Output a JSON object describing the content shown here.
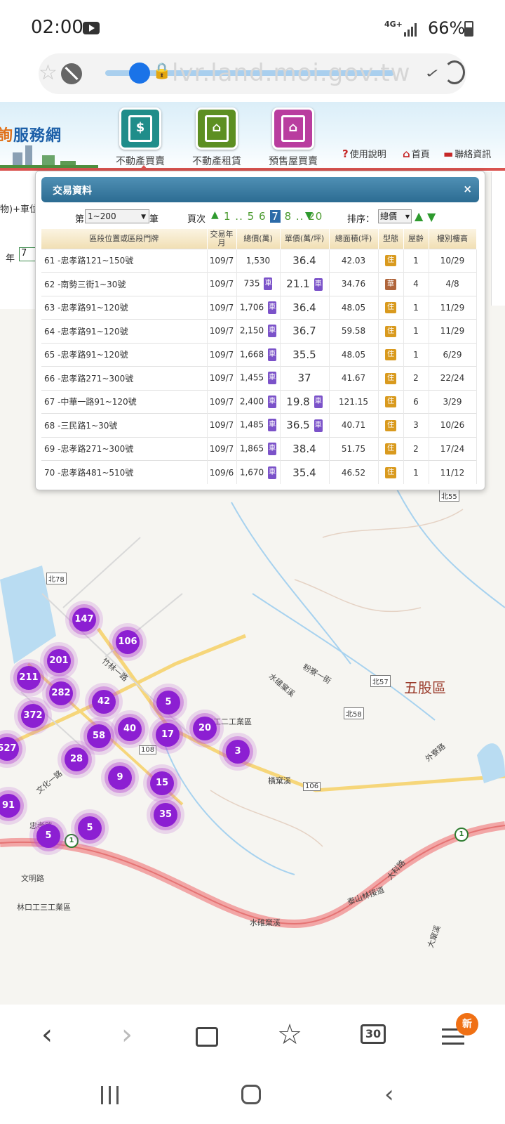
{
  "status_bar": {
    "time": "02:00",
    "network": "4G+",
    "battery_pct": "66%",
    "icons": [
      "youtube-icon",
      "signal-icon",
      "battery-icon"
    ]
  },
  "browser": {
    "url": "lvr.land.moi.gov.tw",
    "load_progress": 0.12,
    "tabs_count": "30",
    "menu_badge": "新",
    "icons": [
      "back-icon",
      "forward-icon",
      "home-icon",
      "bookmarks-icon",
      "tabs-icon",
      "menu-icon"
    ]
  },
  "site": {
    "logo_text_orange": "詢",
    "logo_text_blue": "服務網",
    "nav": [
      {
        "label": "不動產買賣",
        "icon_char": "$",
        "color": "#1f8d8a"
      },
      {
        "label": "不動產租賃",
        "icon_char": "⌂",
        "color": "#5d8f22"
      },
      {
        "label": "預售屋買賣",
        "icon_char": "⌂",
        "color": "#b93d9f"
      }
    ],
    "links": {
      "help": "使用說明",
      "home": "首頁",
      "contact": "聯絡資訊"
    }
  },
  "side_filter": {
    "label": "物)+車位",
    "year_label": "年",
    "year_value": "7"
  },
  "panel": {
    "title": "交易資料",
    "close": "×",
    "range_prefix": "第",
    "range_value": "1~200",
    "range_suffix": "筆",
    "pages_label": "頁次",
    "pages_before": "1 ..",
    "pages_mid_before": "5 6",
    "current_page": "7",
    "pages_after": "8 ..",
    "pages_last": "20",
    "sort_label": "排序：",
    "sort_value": "總價",
    "columns": [
      "區段位置或區段門牌",
      "交易年月",
      "總價(萬)",
      "單價(萬/坪)",
      "總面積(坪)",
      "型態",
      "屋齡",
      "樓別樓高"
    ],
    "rows": [
      {
        "addr": "61 -忠孝路121~150號",
        "date": "109/7",
        "total": "1,530",
        "total_car": false,
        "unit": "36.4",
        "unit_car": false,
        "area": "42.03",
        "type": "住",
        "age": "1",
        "floor": "10/29"
      },
      {
        "addr": "62 -南勢三街1~30號",
        "date": "109/7",
        "total": "735",
        "total_car": true,
        "unit": "21.1",
        "unit_car": true,
        "area": "34.76",
        "type": "華",
        "age": "4",
        "floor": "4/8"
      },
      {
        "addr": "63 -忠孝路91~120號",
        "date": "109/7",
        "total": "1,706",
        "total_car": true,
        "unit": "36.4",
        "unit_car": false,
        "area": "48.05",
        "type": "住",
        "age": "1",
        "floor": "11/29"
      },
      {
        "addr": "64 -忠孝路91~120號",
        "date": "109/7",
        "total": "2,150",
        "total_car": true,
        "unit": "36.7",
        "unit_car": false,
        "area": "59.58",
        "type": "住",
        "age": "1",
        "floor": "11/29"
      },
      {
        "addr": "65 -忠孝路91~120號",
        "date": "109/7",
        "total": "1,668",
        "total_car": true,
        "unit": "35.5",
        "unit_car": false,
        "area": "48.05",
        "type": "住",
        "age": "1",
        "floor": "6/29"
      },
      {
        "addr": "66 -忠孝路271~300號",
        "date": "109/7",
        "total": "1,455",
        "total_car": true,
        "unit": "37",
        "unit_car": false,
        "area": "41.67",
        "type": "住",
        "age": "2",
        "floor": "22/24"
      },
      {
        "addr": "67 -中華一路91~120號",
        "date": "109/7",
        "total": "2,400",
        "total_car": true,
        "unit": "19.8",
        "unit_car": true,
        "area": "121.15",
        "type": "住",
        "age": "6",
        "floor": "3/29"
      },
      {
        "addr": "68 -三民路1~30號",
        "date": "109/7",
        "total": "1,485",
        "total_car": true,
        "unit": "36.5",
        "unit_car": true,
        "area": "40.71",
        "type": "住",
        "age": "3",
        "floor": "10/26"
      },
      {
        "addr": "69 -忠孝路271~300號",
        "date": "109/7",
        "total": "1,865",
        "total_car": true,
        "unit": "38.4",
        "unit_car": false,
        "area": "51.75",
        "type": "住",
        "age": "2",
        "floor": "17/24"
      },
      {
        "addr": "70 -忠孝路481~510號",
        "date": "109/6",
        "total": "1,670",
        "total_car": true,
        "unit": "35.4",
        "unit_car": false,
        "area": "46.52",
        "type": "住",
        "age": "1",
        "floor": "11/12"
      }
    ],
    "car_badge": "車"
  },
  "map": {
    "clusters": [
      "147",
      "106",
      "201",
      "211",
      "282",
      "42",
      "5",
      "372",
      "58",
      "40",
      "17",
      "20",
      "527",
      "28",
      "3",
      "9",
      "15",
      "91",
      "35",
      "5",
      "5"
    ],
    "labels": {
      "district": "五股區",
      "industrial_1": "林口工二工業區",
      "industrial_3": "林口工三工業區",
      "road_zhuxiao": "忠孝路",
      "road_wenming": "文明路",
      "road_wenhua": "文化一路",
      "road_zhulin": "竹林一路",
      "road_dake": "大科路",
      "road_taishan": "泰山林接道",
      "road_waiqiao": "外寮路",
      "stream_shuiduan": "水碓窠溪",
      "stream_heng": "橫窠溪",
      "stream_dake": "大窠溪",
      "stream_shuiduan2": "水碓窠溪",
      "road_fenliao": "粉寮一街"
    },
    "routes": [
      "北78",
      "北57",
      "北58",
      "北55",
      "106",
      "108"
    ],
    "highway": "1"
  }
}
